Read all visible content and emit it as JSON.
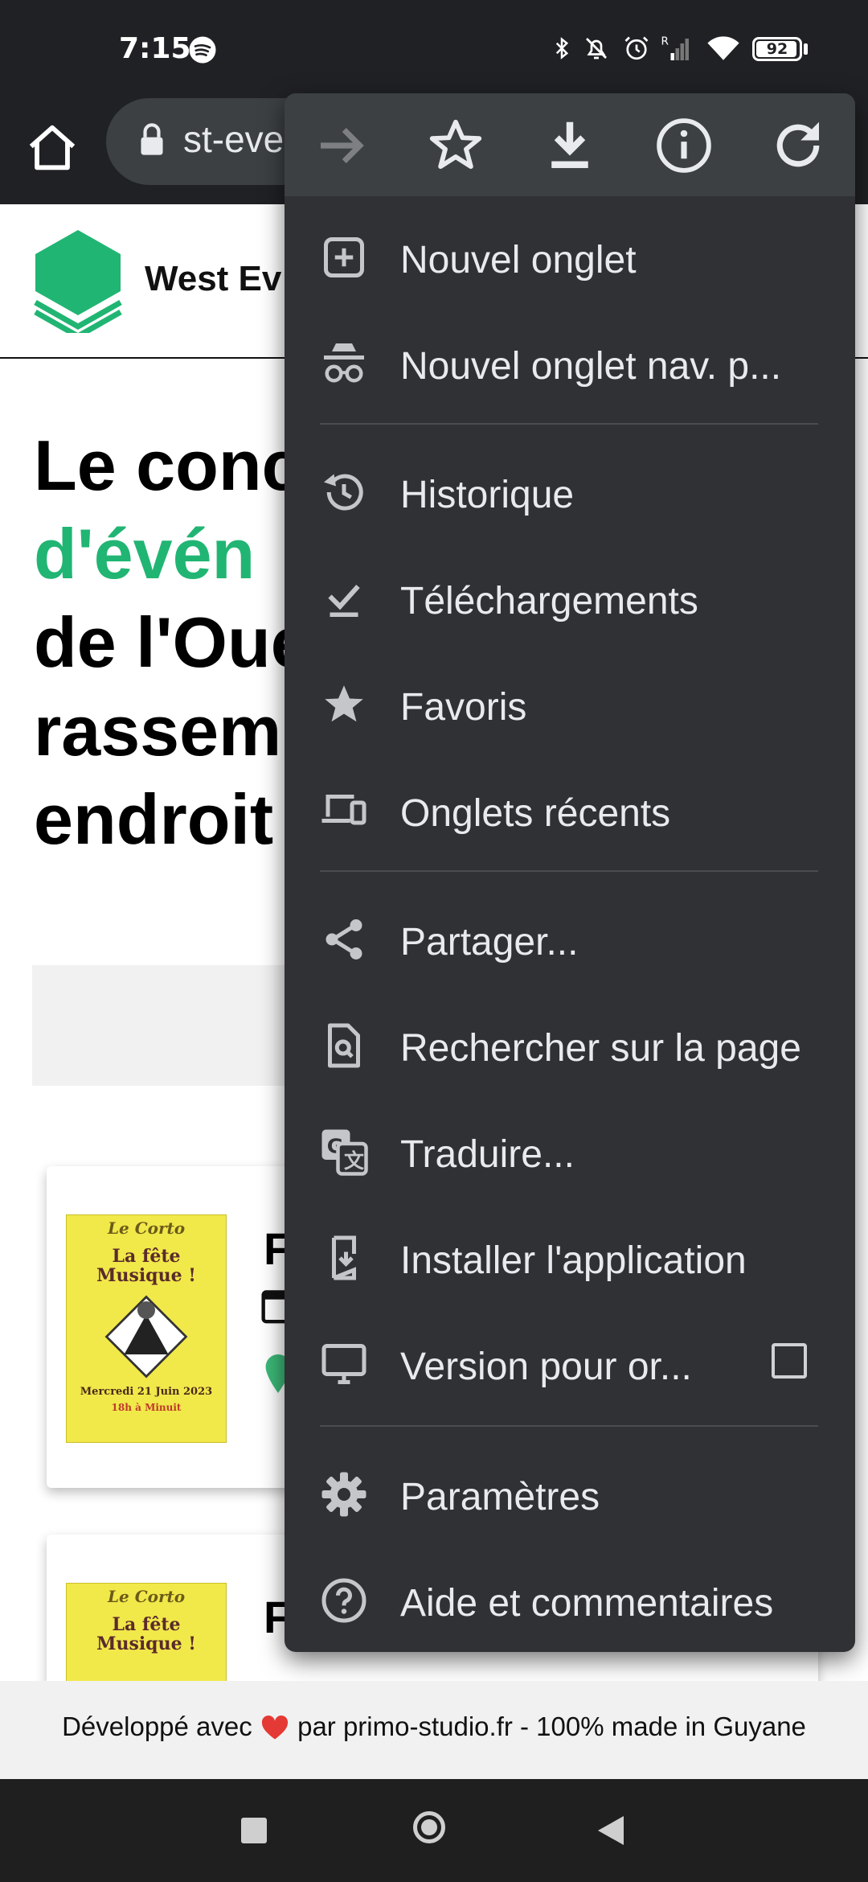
{
  "status_bar": {
    "time": "7:15",
    "battery": "92",
    "icons": [
      "spotify-icon",
      "bluetooth-icon",
      "bell-off-icon",
      "alarm-icon",
      "signal-icon",
      "wifi-icon",
      "battery-icon"
    ]
  },
  "toolbar": {
    "url": "st-eve"
  },
  "site": {
    "title": "West Ev",
    "hero_lines": [
      "Le conc",
      "d'évén",
      "de l'Oue",
      "rassem",
      "endroit"
    ],
    "card_letter": "F"
  },
  "poster": {
    "brand": "Le Corto",
    "title_line1": "La fête",
    "title_line2": "Musique !",
    "date": "Mercredi 21 Juin 2023",
    "hours": "18h à Minuit"
  },
  "menu": {
    "top_icons": [
      "forward-icon",
      "bookmark-star-icon",
      "download-icon",
      "info-icon",
      "refresh-icon"
    ],
    "items": [
      {
        "label": "Nouvel onglet",
        "icon": "new-tab-icon"
      },
      {
        "label": "Nouvel onglet nav. p...",
        "icon": "incognito-icon"
      },
      {
        "label": "Historique",
        "icon": "history-icon"
      },
      {
        "label": "Téléchargements",
        "icon": "downloads-icon"
      },
      {
        "label": "Favoris",
        "icon": "star-icon"
      },
      {
        "label": "Onglets récents",
        "icon": "devices-icon"
      },
      {
        "label": "Partager...",
        "icon": "share-icon"
      },
      {
        "label": "Rechercher sur la page",
        "icon": "find-in-page-icon"
      },
      {
        "label": "Traduire...",
        "icon": "translate-icon"
      },
      {
        "label": "Installer l'application",
        "icon": "install-app-icon"
      },
      {
        "label": "Version pour or...",
        "icon": "desktop-icon"
      },
      {
        "label": "Paramètres",
        "icon": "settings-icon"
      },
      {
        "label": "Aide et commentaires",
        "icon": "help-icon"
      }
    ]
  },
  "footer": {
    "text_before": "Développé avec",
    "text_after": "par primo-studio.fr - 100% made in Guyane"
  },
  "colors": {
    "menu_bg": "#303134",
    "menu_top_bg": "#3c4043",
    "accent_green": "#21b573",
    "chrome_bg": "#202124"
  }
}
